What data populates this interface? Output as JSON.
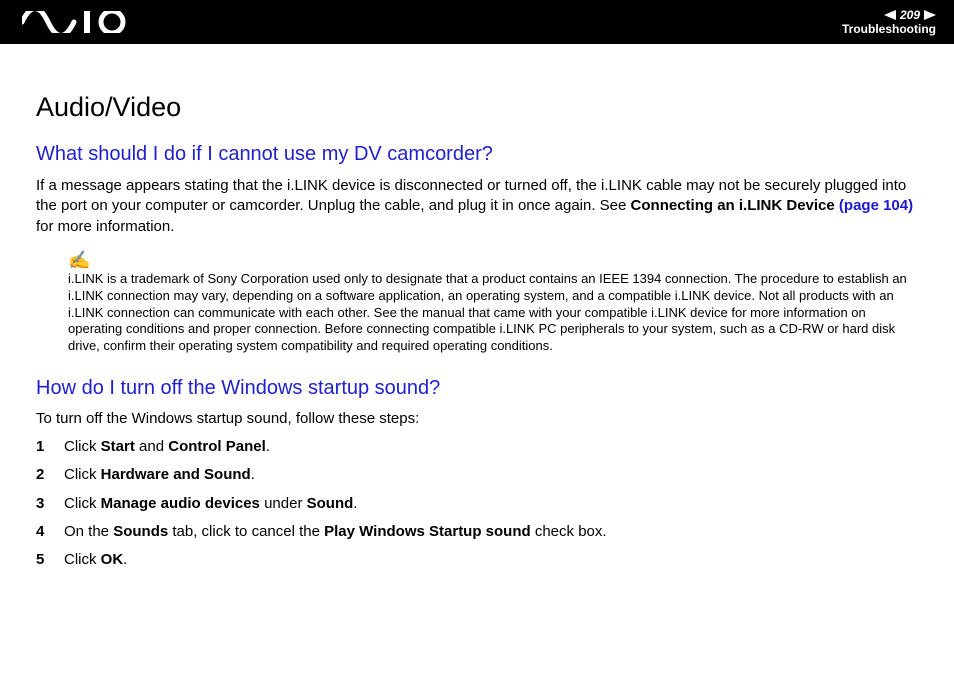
{
  "header": {
    "page_number": "209",
    "breadcrumb": "Troubleshooting"
  },
  "title": "Audio/Video",
  "section1": {
    "heading": "What should I do if I cannot use my DV camcorder?",
    "body_pre": "If a message appears stating that the i.LINK device is disconnected or turned off, the i.LINK cable may not be securely plugged into the port on your computer or camcorder. Unplug the cable, and plug it in once again. See ",
    "body_bold": "Connecting an i.LINK Device ",
    "body_link": "(page 104)",
    "body_post": " for more information.",
    "note": "i.LINK is a trademark of Sony Corporation used only to designate that a product contains an IEEE 1394 connection. The procedure to establish an i.LINK connection may vary, depending on a software application, an operating system, and a compatible i.LINK device. Not all products with an i.LINK connection can communicate with each other. See the manual that came with your compatible i.LINK device for more information on operating conditions and proper connection. Before connecting compatible i.LINK PC peripherals to your system, such as a CD-RW or hard disk drive, confirm their operating system compatibility and required operating conditions."
  },
  "section2": {
    "heading": "How do I turn off the Windows startup sound?",
    "intro": "To turn off the Windows startup sound, follow these steps:",
    "steps": {
      "s1_a": "Click ",
      "s1_b": "Start",
      "s1_c": " and ",
      "s1_d": "Control Panel",
      "s1_e": ".",
      "s2_a": "Click ",
      "s2_b": "Hardware and Sound",
      "s2_c": ".",
      "s3_a": "Click ",
      "s3_b": "Manage audio devices",
      "s3_c": " under ",
      "s3_d": "Sound",
      "s3_e": ".",
      "s4_a": "On the ",
      "s4_b": "Sounds",
      "s4_c": " tab, click to cancel the ",
      "s4_d": "Play Windows Startup sound",
      "s4_e": " check box.",
      "s5_a": "Click ",
      "s5_b": "OK",
      "s5_c": "."
    }
  }
}
